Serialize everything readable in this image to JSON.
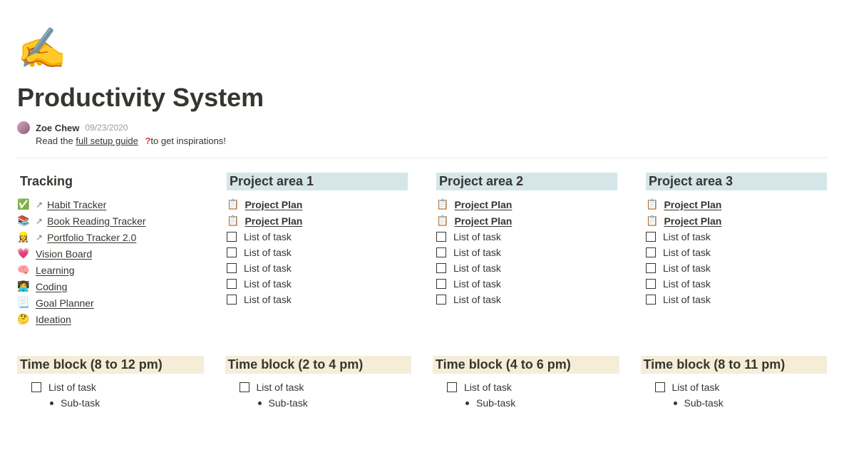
{
  "page": {
    "icon": "✍️",
    "title": "Productivity System",
    "author": "Zoe Chew",
    "date": "09/23/2020",
    "sub_pre": "Read the ",
    "sub_link": "full setup guide",
    "sub_q": "?",
    "sub_post": "to get inspirations!"
  },
  "tracking": {
    "heading": "Tracking",
    "items": [
      {
        "emoji": "✅",
        "arrow": true,
        "label": "Habit Tracker"
      },
      {
        "emoji": "📚",
        "arrow": true,
        "label": "Book Reading Tracker"
      },
      {
        "emoji": "👷‍♀️",
        "arrow": true,
        "label": "Portfolio Tracker 2.0"
      },
      {
        "emoji": "💗",
        "arrow": false,
        "label": "Vision Board"
      },
      {
        "emoji": "🧠",
        "arrow": false,
        "label": "Learning"
      },
      {
        "emoji": "👩‍💻",
        "arrow": false,
        "label": "Coding"
      },
      {
        "emoji": "📃",
        "arrow": false,
        "label": "Goal Planner"
      },
      {
        "emoji": "🤔",
        "arrow": false,
        "label": "Ideation"
      }
    ]
  },
  "projects": [
    {
      "heading": "Project area 1"
    },
    {
      "heading": "Project area 2"
    },
    {
      "heading": "Project area 3"
    }
  ],
  "project_plan_label": "Project Plan",
  "project_plan_emoji": "📋",
  "task_label": "List of task",
  "timeblocks": [
    {
      "heading": "Time block (8 to 12 pm)"
    },
    {
      "heading": "Time block (2 to 4 pm)"
    },
    {
      "heading": "Time block (4 to 6 pm)"
    },
    {
      "heading": "Time block (8 to 11 pm)"
    }
  ],
  "subtask_label": "Sub-task"
}
